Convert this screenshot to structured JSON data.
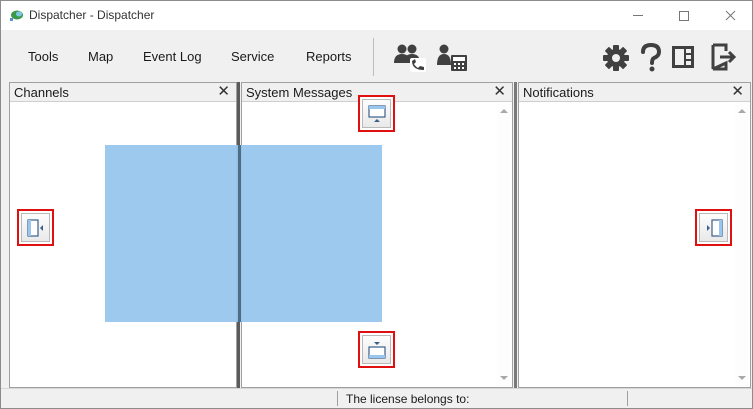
{
  "window": {
    "title": "Dispatcher - Dispatcher"
  },
  "menu": {
    "items": [
      "Tools",
      "Map",
      "Event Log",
      "Service",
      "Reports"
    ]
  },
  "toolbar": {
    "icons": [
      "contacts-phone-icon",
      "contact-fax-icon",
      "settings-gear-icon",
      "help-icon",
      "layout-panel-icon",
      "exit-icon"
    ]
  },
  "panels": {
    "channels": {
      "title": "Channels",
      "close": "✕"
    },
    "system_messages": {
      "title": "System Messages",
      "close": "✕"
    },
    "notifications": {
      "title": "Notifications",
      "close": "✕"
    }
  },
  "status": {
    "license_text": "The license belongs to:"
  },
  "colors": {
    "dock_preview": "#99c6ee",
    "dock_highlight": "#e01010",
    "toolbar_icon": "#404040"
  }
}
